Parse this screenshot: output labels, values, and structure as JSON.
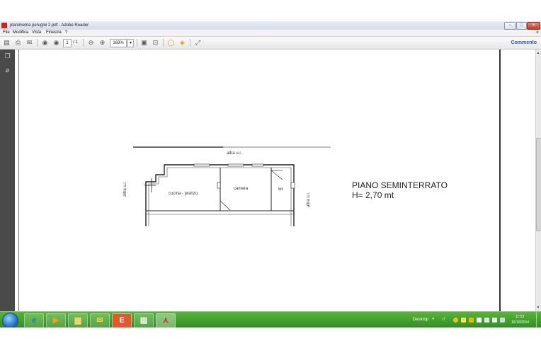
{
  "window": {
    "title": "planimetria perugini 2.pdf - Adobe Reader",
    "min_label": "‒",
    "max_label": "□",
    "close_label": "✕"
  },
  "menu": {
    "items": [
      "File",
      "Modifica",
      "Vista",
      "Finestra",
      "?"
    ],
    "close_x": "×"
  },
  "toolbar": {
    "page_current": "1",
    "page_total": "/ 1",
    "zoom": "169%",
    "zoom_dropdown": "▾",
    "commento": "Commento"
  },
  "document": {
    "plan_labels": {
      "top": "altra u.i.",
      "left": "altra u.i.",
      "right": "altra u.i.",
      "kitchen": "cucina - pranzo",
      "bedroom": "camera",
      "wc": "wc"
    },
    "heading": "PIANO SEMINTERRATO",
    "height_note": "H= 2,70 mt"
  },
  "taskbar": {
    "desktop_label": "Desktop",
    "tray_chevron": "»",
    "language": "IT",
    "time": "11:53",
    "date": "16/10/2014"
  },
  "colors": {
    "taskbar": "#3a9a2a",
    "nav_panel": "#4a4a4a",
    "accent": "#2a5b9c"
  }
}
